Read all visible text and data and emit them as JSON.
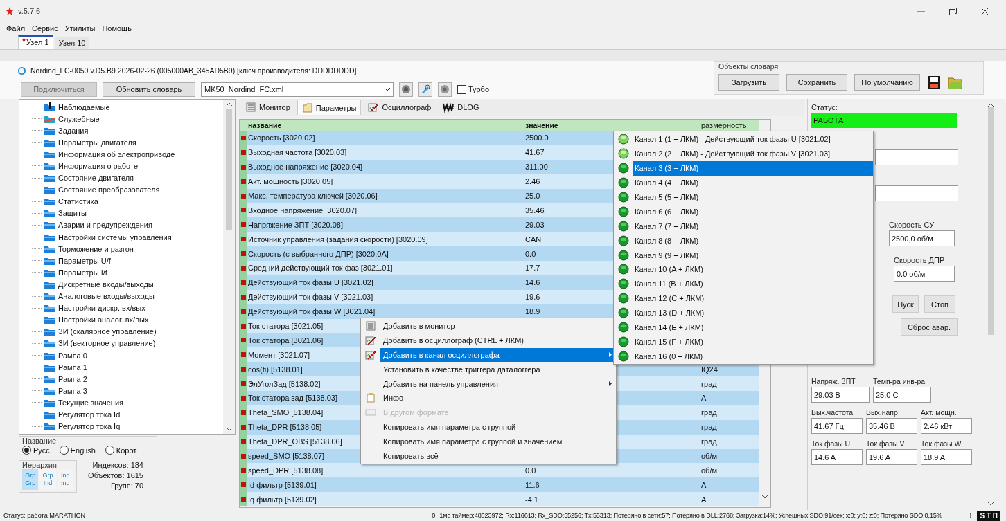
{
  "window": {
    "title": "v.5.7.6"
  },
  "menu": [
    "Файл",
    "Сервис",
    "Утилиты",
    "Помощь"
  ],
  "node_tabs": [
    {
      "label": "Узел 1",
      "selected": true,
      "modified": true
    },
    {
      "label": "Узел 10",
      "selected": false,
      "modified": false
    }
  ],
  "device_info": "Nordind_FC-0050  v.D5.B9  2026-02-26 (005000AB_345AD5B9) [ключ производителя: DDDDDDDD]",
  "toolbar": {
    "connect_button": {
      "label": "Подключиться",
      "disabled": true
    },
    "refresh_button": "Обновить словарь",
    "dictionary_file": "MK50_Nordind_FC.xml",
    "turbo": {
      "label": "Турбо",
      "checked": false
    }
  },
  "dictionary_objects": {
    "title": "Объекты словаря",
    "buttons": [
      "Загрузить",
      "Сохранить",
      "По умолчанию"
    ]
  },
  "tree": {
    "items": [
      {
        "label": "Наблюдаемые",
        "kind": "watch"
      },
      {
        "label": "Служебные",
        "kind": "service"
      },
      {
        "label": "Задания",
        "kind": "group"
      },
      {
        "label": "Параметры двигателя",
        "kind": "group"
      },
      {
        "label": "Информация об электроприводе",
        "kind": "group"
      },
      {
        "label": "Информация о работе",
        "kind": "group"
      },
      {
        "label": "Состояние двигателя",
        "kind": "group"
      },
      {
        "label": "Состояние преобразователя",
        "kind": "group"
      },
      {
        "label": "Статистика",
        "kind": "group"
      },
      {
        "label": "Защиты",
        "kind": "group"
      },
      {
        "label": "Аварии и предупреждения",
        "kind": "group"
      },
      {
        "label": "Настройки системы управления",
        "kind": "group"
      },
      {
        "label": "Торможение и разгон",
        "kind": "group"
      },
      {
        "label": "Параметры U/f",
        "kind": "group"
      },
      {
        "label": "Параметры I/f",
        "kind": "group"
      },
      {
        "label": "Дискретные входы/выходы",
        "kind": "group"
      },
      {
        "label": "Аналоговые входы/выходы",
        "kind": "group"
      },
      {
        "label": "Настройки дискр. вх/вых",
        "kind": "group"
      },
      {
        "label": "Настройки аналог. вх/вых",
        "kind": "group"
      },
      {
        "label": "ЗИ (скалярное управление)",
        "kind": "group"
      },
      {
        "label": "ЗИ (векторное управление)",
        "kind": "group"
      },
      {
        "label": "Рампа 0",
        "kind": "group"
      },
      {
        "label": "Рампа 1",
        "kind": "group"
      },
      {
        "label": "Рампа 2",
        "kind": "group"
      },
      {
        "label": "Рампа 3",
        "kind": "group"
      },
      {
        "label": "Текущие значения",
        "kind": "group"
      },
      {
        "label": "Регулятор тока Id",
        "kind": "group"
      },
      {
        "label": "Регулятор тока Iq",
        "kind": "group"
      }
    ]
  },
  "name_language": {
    "title": "Название",
    "options": [
      {
        "label": "Русс",
        "selected": true
      },
      {
        "label": "English",
        "selected": false
      },
      {
        "label": "Корот",
        "selected": false
      }
    ]
  },
  "hierarchy": {
    "title": "Иерархия",
    "modes": [
      {
        "lines": [
          "Grp",
          "Grp"
        ],
        "selected": true
      },
      {
        "lines": [
          "Grp",
          "Ind"
        ],
        "selected": false
      },
      {
        "lines": [
          "Ind",
          "Ind"
        ],
        "selected": false
      }
    ]
  },
  "stats": [
    "Индексов: 184",
    "Объектов: 1615",
    "Групп: 70"
  ],
  "view_tabs": [
    {
      "label": "Монитор",
      "selected": false
    },
    {
      "label": "Параметры",
      "selected": true
    },
    {
      "label": "Осциллограф",
      "selected": false
    },
    {
      "label": "DLOG",
      "selected": false
    }
  ],
  "table": {
    "columns": [
      "название",
      "значение",
      "размерность"
    ],
    "rows": [
      {
        "name": "Скорость [3020.02]",
        "value": "2500.0"
      },
      {
        "name": "Выходная частота [3020.03]",
        "value": "41.67"
      },
      {
        "name": "Выходное напряжение [3020.04]",
        "value": "311.00"
      },
      {
        "name": "Акт. мощность [3020.05]",
        "value": "2.46"
      },
      {
        "name": "Макс. температура ключей [3020.06]",
        "value": "25.0"
      },
      {
        "name": "Входное напряжение [3020.07]",
        "value": "35.46"
      },
      {
        "name": "Напряжение ЗПТ [3020.08]",
        "value": "29.03"
      },
      {
        "name": "Источник управления (задания скорости) [3020.09]",
        "value": "CAN"
      },
      {
        "name": "Скорость (с выбранного ДПР) [3020.0A]",
        "value": "0.0"
      },
      {
        "name": "Средний действующий ток фаз [3021.01]",
        "value": "17.7"
      },
      {
        "name": "Действующий ток фазы U [3021.02]",
        "value": "14.6"
      },
      {
        "name": "Действующий ток фазы V [3021.03]",
        "value": "19.6"
      },
      {
        "name": "Действующий ток фазы W [3021.04]",
        "value": "18.9"
      },
      {
        "name": "Ток статора [3021.05]"
      },
      {
        "name": "Ток статора [3021.06]"
      },
      {
        "name": "Момент [3021.07]"
      },
      {
        "name": "cos(fi) [5138.01]",
        "unit": "IQ24"
      },
      {
        "name": "ЭлУголЗад [5138.02]",
        "unit": "град"
      },
      {
        "name": "Ток статора зад [5138.03]",
        "unit": "A"
      },
      {
        "name": "Theta_SMO [5138.04]",
        "unit": "град"
      },
      {
        "name": "Theta_DPR [5138.05]",
        "unit": "град"
      },
      {
        "name": "Theta_DPR_OBS [5138.06]",
        "unit": "град"
      },
      {
        "name": "speed_SMO [5138.07]",
        "unit": "об/м"
      },
      {
        "name": "speed_DPR [5138.08]",
        "value": "0.0",
        "unit": "об/м"
      },
      {
        "name": "Id фильтр [5139.01]",
        "value": "11.6",
        "unit": "A"
      },
      {
        "name": "Iq фильтр [5139.02]",
        "value": "-4.1",
        "unit": "A"
      }
    ]
  },
  "context_menu": [
    {
      "label": "Добавить в монитор",
      "selected": false,
      "submenu": false,
      "disabled": false
    },
    {
      "label": "Добавить в осциллограф (CTRL + ЛКМ)",
      "selected": false,
      "submenu": false,
      "disabled": false
    },
    {
      "label": "Добавить в канал осциллографа",
      "selected": true,
      "submenu": true,
      "disabled": false
    },
    {
      "label": "Установить в качестве триггера даталоггера",
      "selected": false,
      "submenu": false,
      "disabled": false
    },
    {
      "label": "Добавить на панель управления",
      "selected": false,
      "submenu": true,
      "disabled": false
    },
    {
      "label": "Инфо",
      "selected": false,
      "submenu": false,
      "disabled": false
    },
    {
      "label": "В другом формате",
      "selected": false,
      "submenu": false,
      "disabled": true
    },
    {
      "label": "Копировать имя параметра с группой",
      "selected": false,
      "submenu": false,
      "disabled": false
    },
    {
      "label": "Копировать имя параметра с группой и значением",
      "selected": false,
      "submenu": false,
      "disabled": false
    },
    {
      "label": "Копировать всё",
      "selected": false,
      "submenu": false,
      "disabled": false
    }
  ],
  "channel_menu": [
    {
      "label": "Канал 1 (1 + ЛКМ) - Действующий ток фазы U [3021.02]",
      "assigned": true,
      "selected": false
    },
    {
      "label": "Канал 2 (2 + ЛКМ) - Действующий ток фазы V [3021.03]",
      "assigned": true,
      "selected": false
    },
    {
      "label": "Канал 3 (3 + ЛКМ)",
      "assigned": false,
      "selected": true
    },
    {
      "label": "Канал 4 (4 + ЛКМ)",
      "assigned": false,
      "selected": false
    },
    {
      "label": "Канал 5 (5 + ЛКМ)",
      "assigned": false,
      "selected": false
    },
    {
      "label": "Канал 6 (6 + ЛКМ)",
      "assigned": false,
      "selected": false
    },
    {
      "label": "Канал 7 (7 + ЛКМ)",
      "assigned": false,
      "selected": false
    },
    {
      "label": "Канал 8 (8 + ЛКМ)",
      "assigned": false,
      "selected": false
    },
    {
      "label": "Канал 9 (9 + ЛКМ)",
      "assigned": false,
      "selected": false
    },
    {
      "label": "Канал 10 (A + ЛКМ)",
      "assigned": false,
      "selected": false
    },
    {
      "label": "Канал 11 (B + ЛКМ)",
      "assigned": false,
      "selected": false
    },
    {
      "label": "Канал 12 (C + ЛКМ)",
      "assigned": false,
      "selected": false
    },
    {
      "label": "Канал 13 (D + ЛКМ)",
      "assigned": false,
      "selected": false
    },
    {
      "label": "Канал 14 (E + ЛКМ)",
      "assigned": false,
      "selected": false
    },
    {
      "label": "Канал 15 (F + ЛКМ)",
      "assigned": false,
      "selected": false
    },
    {
      "label": "Канал 16 (0 + ЛКМ)",
      "assigned": false,
      "selected": false
    }
  ],
  "control_panel": {
    "status_label": "Статус:",
    "status_value": "РАБОТА",
    "speed_cu": {
      "label": "Скорость СУ",
      "value": "2500,0 об/м"
    },
    "speed_dpr": {
      "label": "Скорость ДПР",
      "value": "0.0 об/м"
    },
    "start_button": "Пуск",
    "stop_button": "Стоп",
    "reset_button": "Сброс авар.",
    "readings": [
      [
        {
          "label": "Напряж. ЗПТ",
          "value": "29.03 В"
        },
        {
          "label": "Темп-ра инв-ра",
          "value": "25.0 C"
        }
      ],
      [
        {
          "label": "Вых.частота",
          "value": "41.67 Гц"
        },
        {
          "label": "Вых.напр.",
          "value": "35.46 В"
        },
        {
          "label": "Акт. мощн.",
          "value": "2.46 кВт"
        }
      ],
      [
        {
          "label": "Ток фазы U",
          "value": "14.6 A"
        },
        {
          "label": "Ток фазы V",
          "value": "19.6 A"
        },
        {
          "label": "Ток фазы W",
          "value": "18.9 A"
        }
      ]
    ]
  },
  "status_bar": {
    "status": "Статус: работа MARATHON",
    "counter": "0",
    "stats": "1мс таймер:48023972; Rx:116613; Rx_SDO:55256; Tx:55313; Потеряно в сети:57; Потеряно в DLL:2768; Загрузка:14%; Успешных SDO:91/сек; x:0; y:0; z:0; Потеряно SDO:0,15%",
    "warning": "!",
    "badge": "S T П"
  }
}
